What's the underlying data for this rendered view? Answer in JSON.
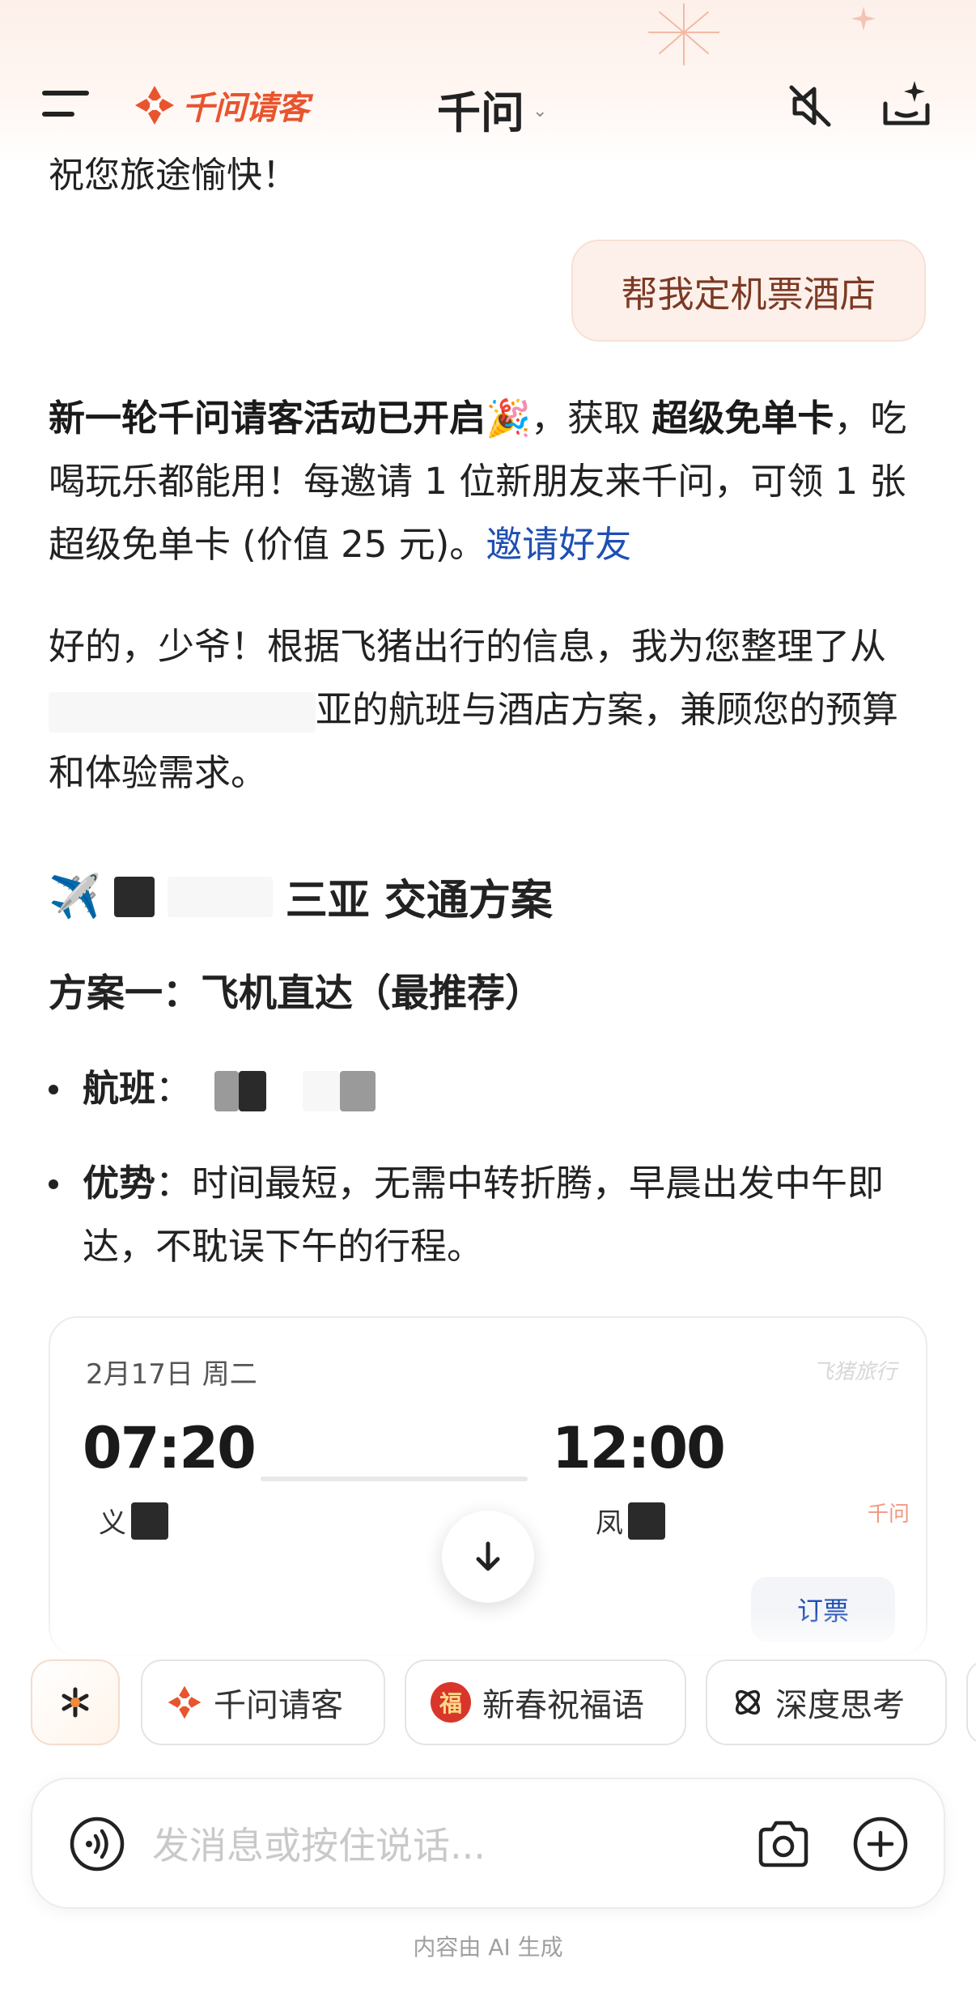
{
  "header": {
    "logo_text": "千问请客",
    "title": "千问",
    "title_chevron": "⌄",
    "menu_icon": "menu-icon",
    "mute_icon": "speaker-muted-icon",
    "new_chat_icon": "new-chat-sparkle-icon"
  },
  "chat": {
    "cut_line": "祝您旅途愉快！",
    "user_message": "帮我定机票酒店",
    "promo": {
      "part1": "新一轮千问请客活动已开启",
      "emoji": "🎉",
      "part2": "，获取 ",
      "bold": "超级免单卡",
      "part3": "，吃喝玩乐都能用！每邀请 1 位新朋友来千问，可领 1 张超级免单卡 (价值 25 元)。",
      "link": "邀请好友"
    },
    "reply": {
      "part1": "好的，少爷！根据飞猪出行的信息，我为您整理了从",
      "part2": "亚的航班与酒店方案，兼顾您的预算和体验需求。"
    },
    "section_title_emoji": "✈️",
    "section_title_suffix": "三亚 交通方案",
    "plan_title": "方案一：飞机直达（最推荐）",
    "bullets": [
      {
        "label": "航班",
        "sep": "：",
        "text": ""
      },
      {
        "label": "优势",
        "sep": "：",
        "text": "时间最短，无需中转折腾，早晨出发中午即达，不耽误下午的行程。"
      }
    ]
  },
  "flight_card": {
    "date": "2月17日 周二",
    "brand": "飞猪旅行",
    "depart_time": "07:20",
    "arrive_time": "12:00",
    "depart_city_initial": "义",
    "arrive_city_initial": "凤",
    "tag": "千问",
    "book_label": "订票"
  },
  "scroll_down_icon": "arrow-down-icon",
  "chips": [
    {
      "label": "",
      "icon": "ai-spark-icon"
    },
    {
      "label": "千问请客",
      "icon": "qianwen-logo-icon"
    },
    {
      "label": "新春祝福语",
      "icon": "fu-badge-icon",
      "badge": "福"
    },
    {
      "label": "深度思考",
      "icon": "deep-think-icon"
    }
  ],
  "input": {
    "placeholder": "发消息或按住说话...",
    "voice_icon": "voice-wave-icon",
    "camera_icon": "camera-icon",
    "plus_icon": "plus-circle-icon"
  },
  "footer_note": "内容由 AI 生成",
  "colors": {
    "accent": "#e8542e",
    "link": "#1f4fb3",
    "bubble_bg": "#fdf0ea",
    "bubble_text": "#7b3a24"
  }
}
